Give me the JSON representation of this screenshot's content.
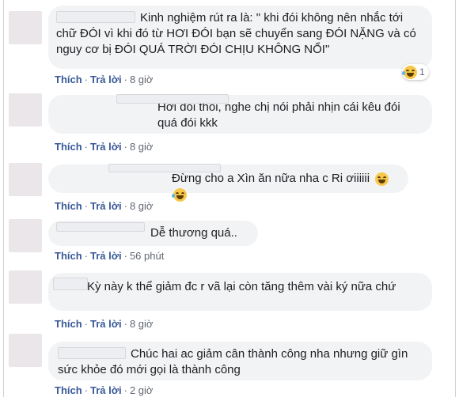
{
  "comments": [
    {
      "text": "Kinh nghiệm rút ra là: \" khi đói không nên nhắc tới chữ ĐÓI vì khi đó từ HƠI ĐÓI bạn sẽ chuyển sang ĐÓI NẶNG và có nguy cơ bị ĐÓI QUÁ TRỜI ĐÓI CHỊU KHÔNG NỔI\"",
      "like": "Thích",
      "reply": "Trả lời",
      "time": "8 giờ",
      "reaction_count": "1"
    },
    {
      "text": "Hơi đói thôi, nghe chị nói phải nhịn cái kêu đói quá đói kkk",
      "like": "Thích",
      "reply": "Trả lời",
      "time": "8 giờ"
    },
    {
      "text": "Đừng cho a Xìn ăn nữa nha c Ri ơiiiiii",
      "like": "Thích",
      "reply": "Trả lời",
      "time": "8 giờ"
    },
    {
      "text": "Dễ thương quá..",
      "like": "Thích",
      "reply": "Trả lời",
      "time": "56 phút"
    },
    {
      "text": "Kỳ này k thể giảm đc r vã lại còn tăng thêm vài ký nữa chứ",
      "like": "Thích",
      "reply": "Trả lời",
      "time": "8 giờ"
    },
    {
      "text": "Chúc hai ac giảm cân thành công nha nhưng giữ gìn sức khỏe đó mới gọi là thành công",
      "like": "Thích",
      "reply": "Trả lời",
      "time": "2 giờ"
    }
  ],
  "separator": "·",
  "reaction_icon": "laughing-emoji-icon",
  "colors": {
    "bubble": "#f2f3f5",
    "link": "#385898",
    "meta": "#606770",
    "avatar": "#eae6ea"
  }
}
